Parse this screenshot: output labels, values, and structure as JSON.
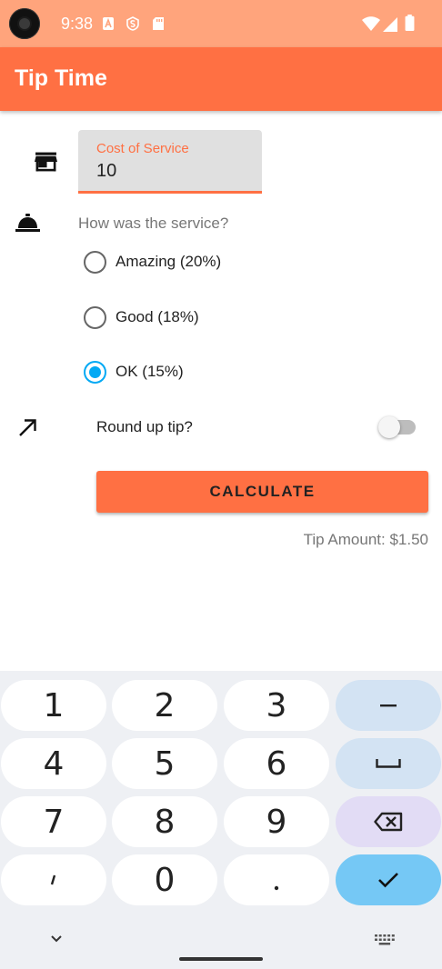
{
  "status_bar": {
    "time": "9:38",
    "notification_icons": [
      "a-box-icon",
      "s-badge-icon",
      "sd-card-icon"
    ],
    "system_icons": [
      "wifi-icon",
      "signal-icon",
      "battery-icon"
    ]
  },
  "app_bar": {
    "title": "Tip Time",
    "color": "#ff7043"
  },
  "cost_field": {
    "label": "Cost of Service",
    "value": "10",
    "icon": "storefront-icon"
  },
  "service_question": {
    "text": "How was the service?",
    "icon": "room-service-bell-icon",
    "options": [
      {
        "label": "Amazing (20%)",
        "selected": false
      },
      {
        "label": "Good (18%)",
        "selected": false
      },
      {
        "label": "OK (15%)",
        "selected": true
      }
    ]
  },
  "round_up": {
    "label": "Round up tip?",
    "icon": "arrow-up-right-icon",
    "enabled": false
  },
  "calculate_button": {
    "label": "CALCULATE"
  },
  "result": {
    "text": "Tip Amount: $1.50"
  },
  "keyboard": {
    "rows": [
      [
        "1",
        "2",
        "3",
        "–"
      ],
      [
        "4",
        "5",
        "6",
        "␣"
      ],
      [
        "7",
        "8",
        "9",
        "⌫"
      ],
      [
        ",",
        "0",
        ".",
        "✓"
      ]
    ],
    "hide_icon": "chevron-down-icon",
    "switch_icon": "keyboard-icon"
  },
  "colors": {
    "accent": "#ff7043",
    "status_bar": "#ffa47c",
    "radio_selected": "#03a9f4",
    "key_done": "#75c8f5",
    "key_fn": "#d3e3f3",
    "key_delete": "#e2dcf5"
  }
}
